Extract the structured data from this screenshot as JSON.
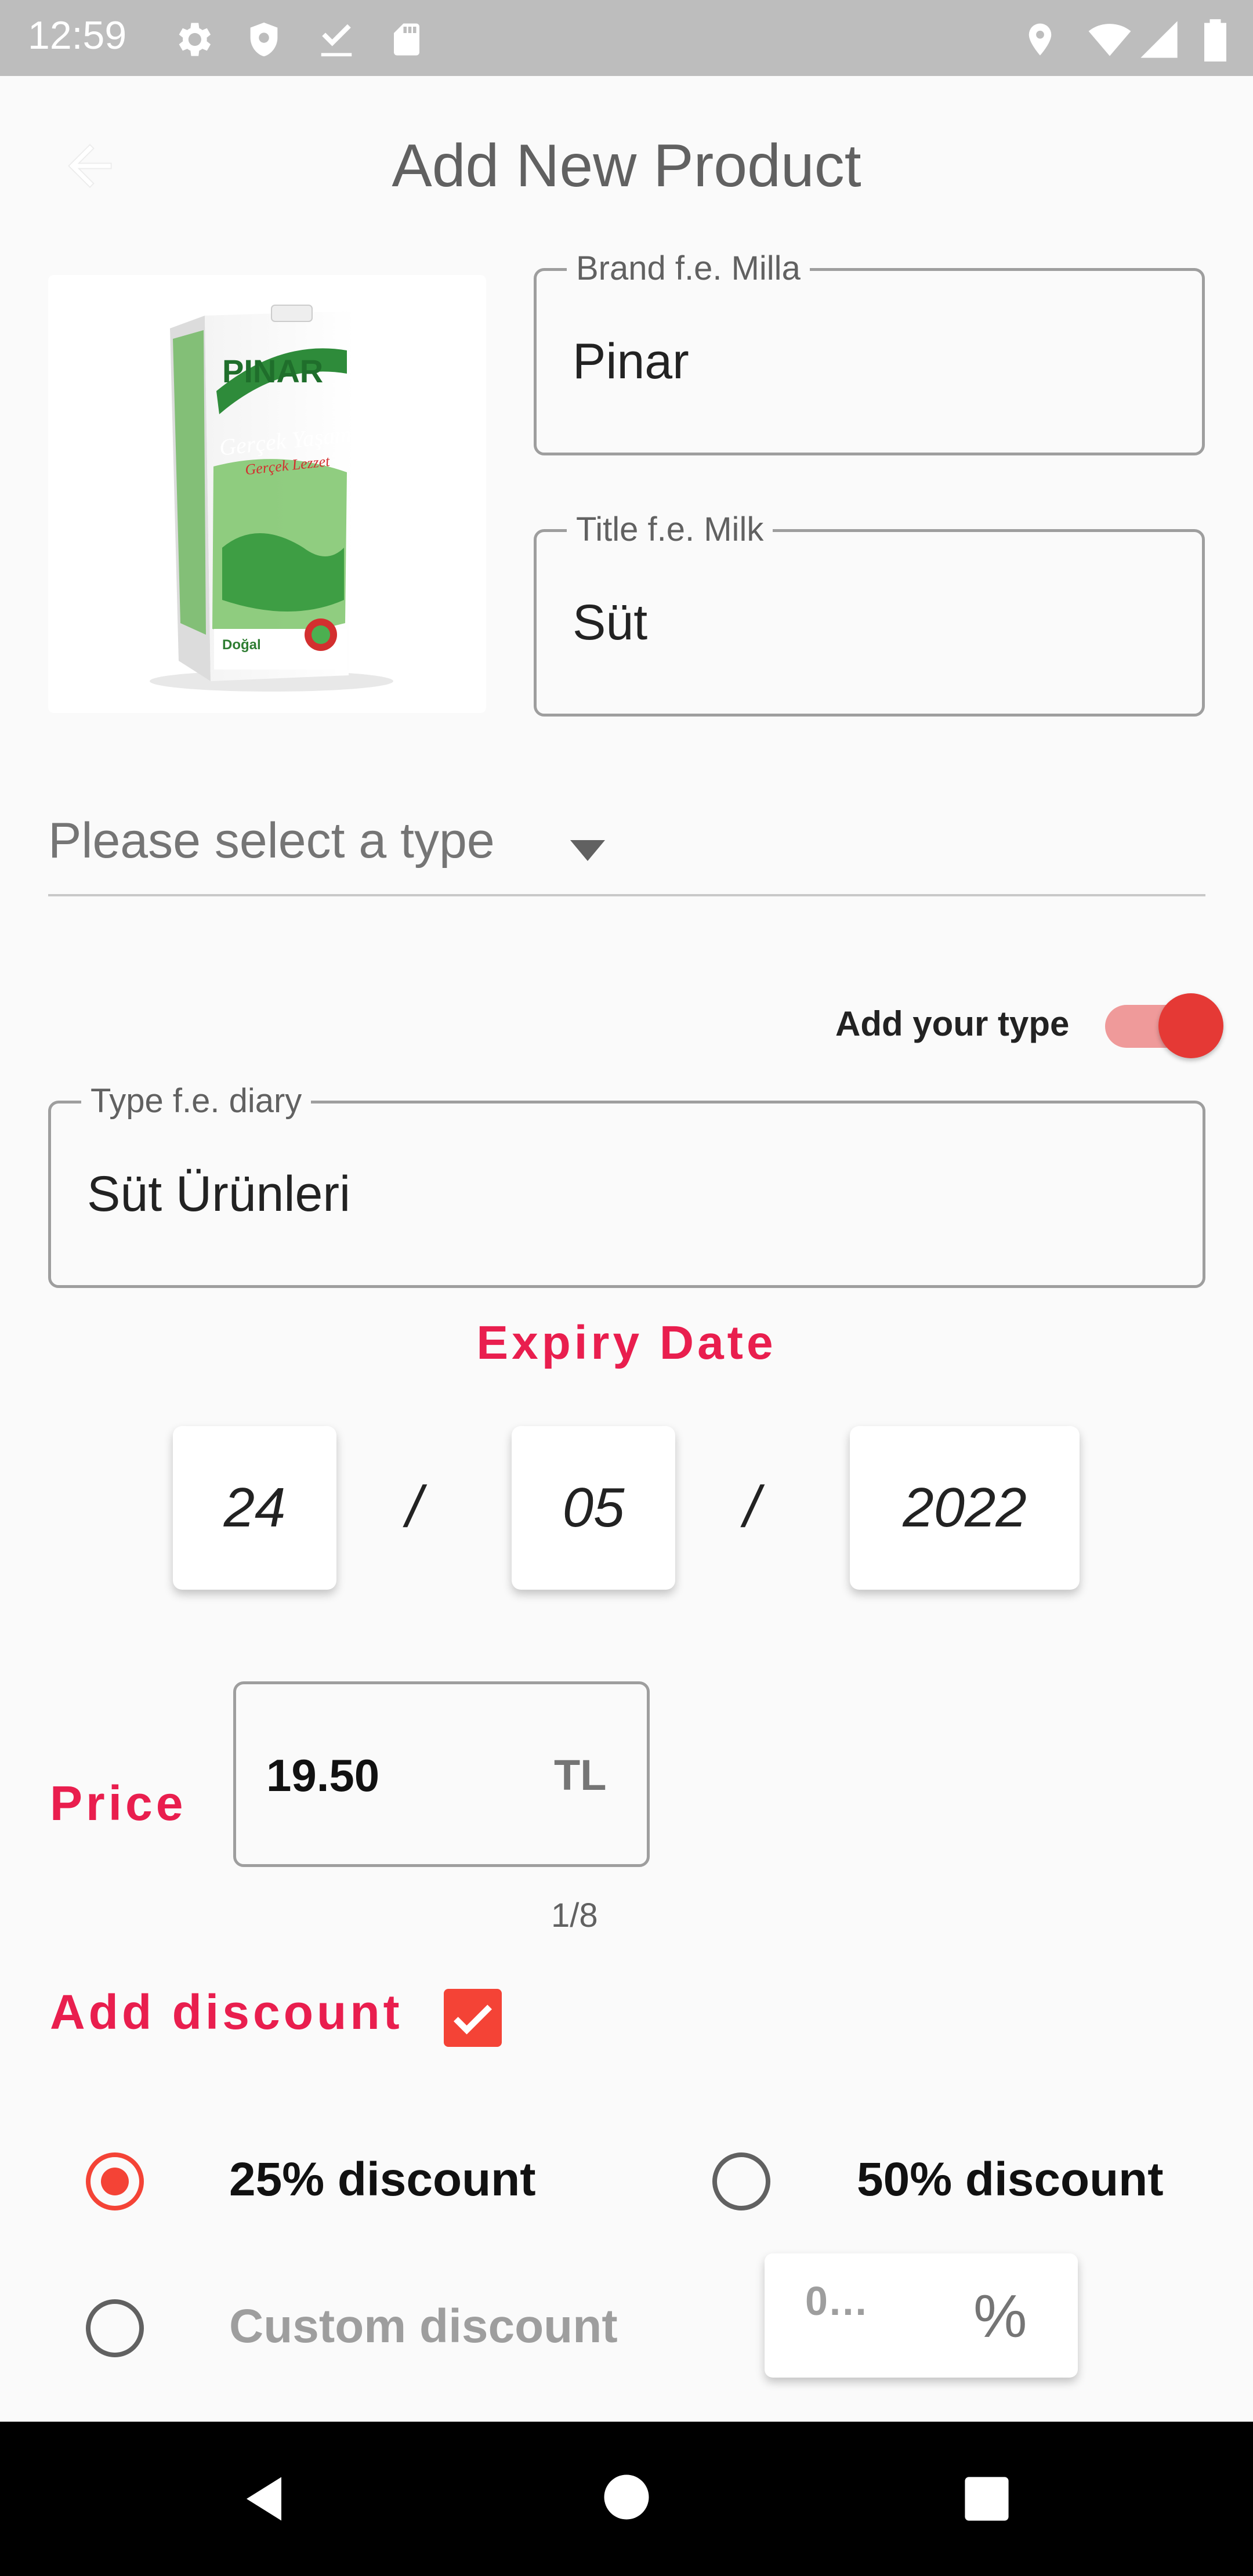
{
  "status_bar": {
    "time": "12:59",
    "left_icons": [
      "gear-icon",
      "shield-icon",
      "download-check-icon",
      "sd-card-icon"
    ],
    "right_icons": [
      "location-icon",
      "wifi-icon",
      "signal-icon",
      "battery-icon"
    ]
  },
  "header": {
    "title": "Add New Product",
    "back_icon": "arrow-left-icon"
  },
  "product": {
    "brand_label": "Brand f.e. Milla",
    "brand_value": "Pinar",
    "title_label": "Title f.e. Milk",
    "title_value": "Süt",
    "image_text": {
      "brand": "PINAR",
      "line1": "Gerçek Yaşam",
      "line2": "Gerçek Lezzet",
      "line3": "Doğal"
    }
  },
  "type_dropdown": {
    "placeholder": "Please select a type"
  },
  "custom_type": {
    "switch_label": "Add your type",
    "switch_on": true,
    "field_label": "Type f.e. diary",
    "field_value": "Süt Ürünleri"
  },
  "expiry": {
    "title": "Expiry Date",
    "day": "24",
    "month": "05",
    "year": "2022",
    "separator": "/"
  },
  "price": {
    "label": "Price",
    "value": "19.50",
    "currency": "TL",
    "counter": "1/8"
  },
  "discount": {
    "label": "Add discount",
    "checked": true,
    "options": [
      {
        "label": "25% discount",
        "selected": true
      },
      {
        "label": "50% discount",
        "selected": false
      },
      {
        "label": "Custom discount",
        "selected": false
      }
    ],
    "custom_placeholder": "0…",
    "custom_suffix": "%"
  },
  "colors": {
    "accent": "#f44336",
    "section_title": "#e91e4e",
    "status_bar": "#bdbdbd"
  },
  "nav_bar": {
    "icons": [
      "back-triangle-icon",
      "home-circle-icon",
      "recents-square-icon"
    ]
  }
}
